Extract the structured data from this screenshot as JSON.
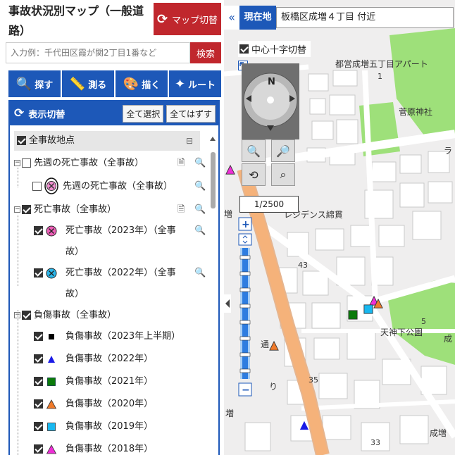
{
  "header": {
    "title": "事故状況別マップ（一般道路）",
    "switch_label": "マップ切替",
    "search_placeholder": "入力例：千代田区霞が関2丁目1番など",
    "search_button": "検索"
  },
  "tools": [
    {
      "label": "探す",
      "icon": "search-icon"
    },
    {
      "label": "測る",
      "icon": "ruler-icon"
    },
    {
      "label": "描く",
      "icon": "palette-icon"
    },
    {
      "label": "ルート",
      "icon": "route-icon"
    }
  ],
  "panel": {
    "title": "表示切替",
    "select_all": "全て選択",
    "deselect_all": "全てはずす",
    "root_label": "全事故地点",
    "groups": [
      {
        "label": "先週の死亡事故（全事故）",
        "checked": false,
        "items": [
          {
            "label": "先週の死亡事故（全事故）",
            "checked": false,
            "symbol": "circle-x-pink"
          }
        ]
      },
      {
        "label": "死亡事故（全事故）",
        "checked": true,
        "items": [
          {
            "label": "死亡事故（2023年）（全事故）",
            "checked": true,
            "symbol": "circle-x-magenta"
          },
          {
            "label": "死亡事故（2022年）（全事故）",
            "checked": true,
            "symbol": "circle-x-cyan"
          }
        ]
      },
      {
        "label": "負傷事故（全事故）",
        "checked": true,
        "items": [
          {
            "label": "負傷事故（2023年上半期）",
            "checked": true,
            "symbol": "square-black"
          },
          {
            "label": "負傷事故（2022年）",
            "checked": true,
            "symbol": "triangle-blue"
          },
          {
            "label": "負傷事故（2021年）",
            "checked": true,
            "symbol": "square-green"
          },
          {
            "label": "負傷事故（2020年）",
            "checked": true,
            "symbol": "triangle-orange"
          },
          {
            "label": "負傷事故（2019年）",
            "checked": true,
            "symbol": "square-cyan"
          },
          {
            "label": "負傷事故（2018年）",
            "checked": true,
            "symbol": "triangle-magenta"
          }
        ]
      }
    ],
    "group_line1": [
      "死亡事故（2023年）（全事",
      "死亡事故（2022年）（全事"
    ],
    "group_line2": [
      "故）",
      "故）"
    ]
  },
  "map": {
    "location_label": "現在地",
    "address": "板橋区成増４丁目 付近",
    "back_icon": "«",
    "center_cross_label": "中心十字切替",
    "scale": "1/2500",
    "labels": {
      "apartment": "都営成増五丁目アパート",
      "shrine": "菅原神社",
      "residence": "レジデンス綿貫",
      "park": "天神下公園",
      "n1": "1",
      "n43": "43",
      "n5": "5",
      "n35": "35",
      "n33": "33",
      "ra": "ラ",
      "seizo": "成増",
      "tori": "通",
      "ri": "り",
      "zou": "増",
      "zou2": "増",
      "sai": "成"
    },
    "colors": {
      "accent": "#1d58b8",
      "red": "#c0272d",
      "park": "#9ee07a",
      "road": "#f5b27a"
    }
  }
}
